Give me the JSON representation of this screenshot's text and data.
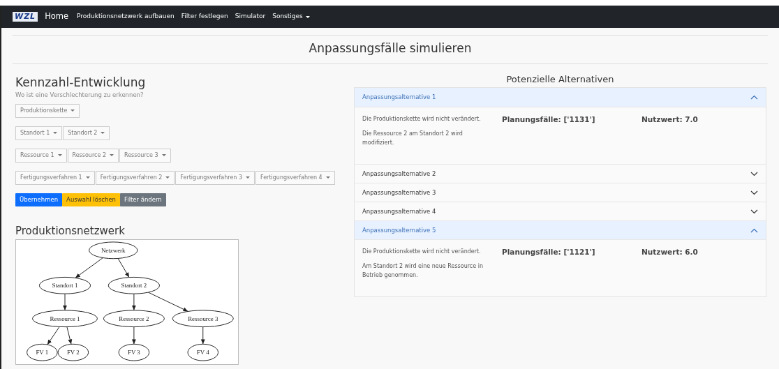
{
  "navbar": {
    "brand": "WZL",
    "items": [
      {
        "label": "Home",
        "kind": "home",
        "dropdown": false
      },
      {
        "label": "Produktionsnetzwerk aufbauen",
        "kind": "link",
        "dropdown": false
      },
      {
        "label": "Filter festlegen",
        "kind": "link",
        "dropdown": false
      },
      {
        "label": "Simulator",
        "kind": "link",
        "dropdown": false
      },
      {
        "label": "Sonstiges",
        "kind": "link",
        "dropdown": true
      }
    ]
  },
  "page_title": "Anpassungsfälle simulieren",
  "kennzahl": {
    "title": "Kennzahl-Entwicklung",
    "subtitle": "Wo ist eine Verschlechterung zu erkennen?",
    "dropdown_rows": [
      [
        "Produktionskette"
      ],
      [
        "Standort 1",
        "Standort 2"
      ],
      [
        "Ressource 1",
        "Ressource 2",
        "Ressource 3"
      ],
      [
        "Fertigungsverfahren 1",
        "Fertigungsverfahren 2",
        "Fertigungsverfahren 3",
        "Fertigungsverfahren 4"
      ]
    ],
    "buttons": [
      {
        "label": "Übernehmen",
        "kind": "primary"
      },
      {
        "label": "Auswahl löschen",
        "kind": "warning"
      },
      {
        "label": "Filter ändern",
        "kind": "secondary"
      }
    ]
  },
  "netzwerk": {
    "title": "Produktionsnetzwerk",
    "tree": {
      "label": "Netzwerk",
      "children": [
        {
          "label": "Standort 1",
          "children": [
            {
              "label": "Ressource 1",
              "children": [
                {
                  "label": "FV 1"
                },
                {
                  "label": "FV 2"
                }
              ]
            }
          ]
        },
        {
          "label": "Standort 2",
          "children": [
            {
              "label": "Ressource 2",
              "children": [
                {
                  "label": "FV 3"
                }
              ]
            },
            {
              "label": "Ressource 3",
              "children": [
                {
                  "label": "FV 4"
                }
              ]
            }
          ]
        }
      ]
    }
  },
  "alternativen": {
    "title": "Potenzielle Alternativen",
    "items": [
      {
        "title": "Anpassungsalternative 1",
        "expanded": true,
        "lines": [
          "Die Produktionskette wird nicht verändert.",
          "Die Ressource 2 am Standort 2 wird modifiziert."
        ],
        "cases": "Planungsfälle: ['1131']",
        "value": "Nutzwert: 7.0"
      },
      {
        "title": "Anpassungsalternative 2",
        "expanded": false
      },
      {
        "title": "Anpassungsalternative 3",
        "expanded": false
      },
      {
        "title": "Anpassungsalternative 4",
        "expanded": false
      },
      {
        "title": "Anpassungsalternative 5",
        "expanded": true,
        "lines": [
          "Die Produktionskette wird nicht verändert.",
          "Am Standort 2 wird eine neue Ressource in Betrieb genommen."
        ],
        "cases": "Planungsfälle: ['1121']",
        "value": "Nutzwert: 6.0"
      }
    ]
  }
}
